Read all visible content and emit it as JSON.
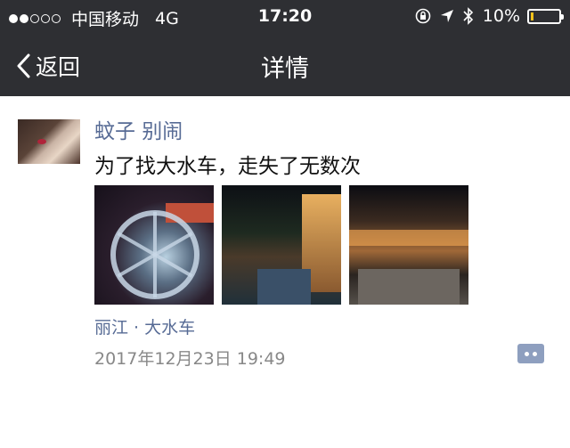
{
  "status_bar": {
    "carrier": "中国移动",
    "network": "4G",
    "time": "17:20",
    "battery_percent_label": "10%",
    "battery_level": 0.1,
    "battery_color": "#f4c21b",
    "signal_bars_filled": 2,
    "signal_bars_total": 5
  },
  "nav": {
    "back_label": "返回",
    "title": "详情",
    "background_color": "#2e2f33"
  },
  "post": {
    "username": "蚊子 别闹",
    "text": "为了找大水车，走失了无数次",
    "location": "丽江 · 大水车",
    "timestamp": "2017年12月23日 19:49",
    "link_color": "#576b95",
    "photo_count": 3
  },
  "icons": {
    "back": "chevron-left-icon",
    "comment": "comment-dots-icon",
    "lock_rotation": "rotation-lock-icon",
    "location": "location-arrow-icon",
    "bluetooth": "bluetooth-icon",
    "battery": "battery-icon"
  }
}
